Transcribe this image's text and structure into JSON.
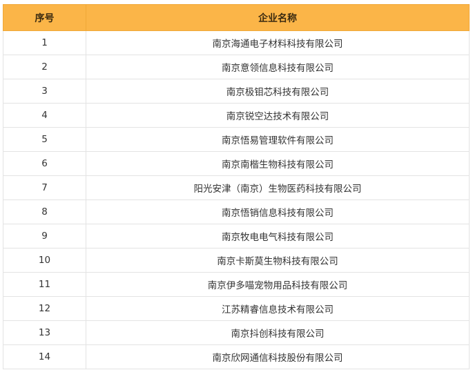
{
  "table": {
    "headers": [
      "序号",
      "企业名称"
    ],
    "rows": [
      [
        "1",
        "南京海通电子材料科技有限公司"
      ],
      [
        "2",
        "南京意领信息科技有限公司"
      ],
      [
        "3",
        "南京极钼芯科技有限公司"
      ],
      [
        "4",
        "南京锐空达技术有限公司"
      ],
      [
        "5",
        "南京悟易管理软件有限公司"
      ],
      [
        "6",
        "南京南楷生物科技有限公司"
      ],
      [
        "7",
        "阳光安津（南京）生物医药科技有限公司"
      ],
      [
        "8",
        "南京悟销信息科技有限公司"
      ],
      [
        "9",
        "南京牧电电气科技有限公司"
      ],
      [
        "10",
        "南京卡斯莫生物科技有限公司"
      ],
      [
        "11",
        "南京伊多喵宠物用品科技有限公司"
      ],
      [
        "12",
        "江苏精睿信息技术有限公司"
      ],
      [
        "13",
        "南京抖创科技有限公司"
      ],
      [
        "14",
        "南京欣网通信科技股份有限公司"
      ]
    ]
  },
  "colors": {
    "header_bg": "#fbb548",
    "border": "#e3e3e3"
  }
}
